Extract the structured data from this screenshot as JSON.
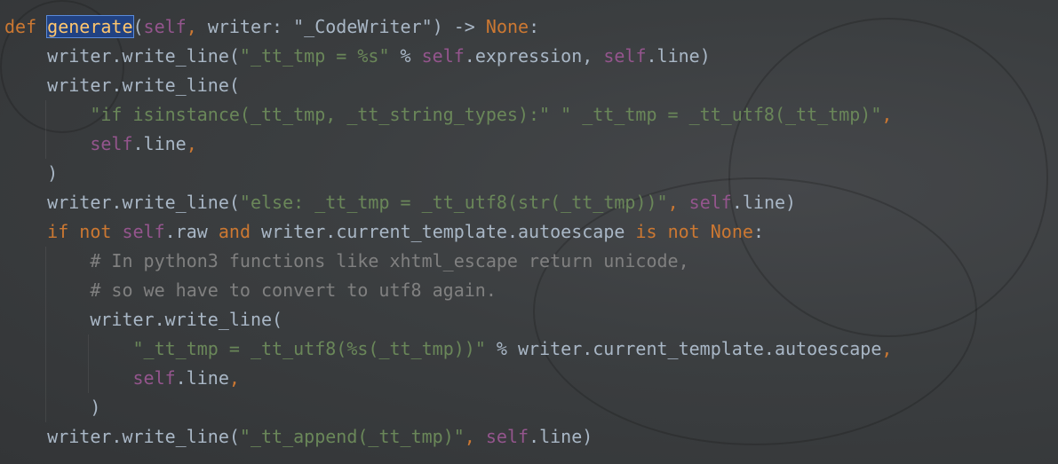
{
  "editor": {
    "language": "python",
    "colors": {
      "keyword": "#cc7832",
      "self": "#94558d",
      "string": "#6a8759",
      "comment": "#808080",
      "text": "#a9b7c6",
      "selection": "#214283"
    },
    "lines": [
      {
        "indent": 0,
        "tokens": [
          [
            "def ",
            "kw"
          ],
          [
            "generate",
            "sel"
          ],
          [
            "(",
            "txt"
          ],
          [
            "self",
            "self"
          ],
          [
            ", ",
            "kw"
          ],
          [
            "writer: ",
            "txt"
          ],
          [
            "\"_CodeWriter\"",
            "txt"
          ],
          [
            ") -> ",
            "txt"
          ],
          [
            "None",
            "kw"
          ],
          [
            ":",
            "txt"
          ]
        ]
      },
      {
        "indent": 1,
        "tokens": [
          [
            "writer.write_line(",
            "txt"
          ],
          [
            "\"_tt_tmp = %s\"",
            "str"
          ],
          [
            " % ",
            "txt"
          ],
          [
            "self",
            "self"
          ],
          [
            ".expression, ",
            "txt"
          ],
          [
            "self",
            "self"
          ],
          [
            ".line)",
            "txt"
          ]
        ]
      },
      {
        "indent": 1,
        "tokens": [
          [
            "writer.write_line(",
            "txt"
          ]
        ]
      },
      {
        "indent": 2,
        "tokens": [
          [
            "\"if isinstance(_tt_tmp, _tt_string_types):\" \" _tt_tmp = _tt_utf8(_tt_tmp)\"",
            "str"
          ],
          [
            ",",
            "kw"
          ]
        ]
      },
      {
        "indent": 2,
        "tokens": [
          [
            "self",
            "self"
          ],
          [
            ".line",
            "txt"
          ],
          [
            ",",
            "kw"
          ]
        ]
      },
      {
        "indent": 1,
        "tokens": [
          [
            ")",
            "txt"
          ]
        ]
      },
      {
        "indent": 1,
        "tokens": [
          [
            "writer.write_line(",
            "txt"
          ],
          [
            "\"else: _tt_tmp = _tt_utf8(str(_tt_tmp))\"",
            "str"
          ],
          [
            ", ",
            "kw"
          ],
          [
            "self",
            "self"
          ],
          [
            ".line)",
            "txt"
          ]
        ]
      },
      {
        "indent": 1,
        "tokens": [
          [
            "if not ",
            "kw"
          ],
          [
            "self",
            "self"
          ],
          [
            ".raw ",
            "txt"
          ],
          [
            "and ",
            "kw"
          ],
          [
            "writer.current_template.autoescape ",
            "txt"
          ],
          [
            "is not ",
            "kw"
          ],
          [
            "None",
            "kw"
          ],
          [
            ":",
            "txt"
          ]
        ]
      },
      {
        "indent": 2,
        "tokens": [
          [
            "# In python3 functions like xhtml_escape return unicode,",
            "cm"
          ]
        ]
      },
      {
        "indent": 2,
        "tokens": [
          [
            "# so we have to convert to utf8 again.",
            "cm"
          ]
        ]
      },
      {
        "indent": 2,
        "tokens": [
          [
            "writer.write_line(",
            "txt"
          ]
        ]
      },
      {
        "indent": 3,
        "tokens": [
          [
            "\"_tt_tmp = _tt_utf8(%s(_tt_tmp))\"",
            "str"
          ],
          [
            " % writer.current_template.autoescape",
            "txt"
          ],
          [
            ",",
            "kw"
          ]
        ]
      },
      {
        "indent": 3,
        "tokens": [
          [
            "self",
            "self"
          ],
          [
            ".line",
            "txt"
          ],
          [
            ",",
            "kw"
          ]
        ]
      },
      {
        "indent": 2,
        "tokens": [
          [
            ")",
            "txt"
          ]
        ]
      },
      {
        "indent": 1,
        "tokens": [
          [
            "writer.write_line(",
            "txt"
          ],
          [
            "\"_tt_append(_tt_tmp)\"",
            "str"
          ],
          [
            ", ",
            "kw"
          ],
          [
            "self",
            "self"
          ],
          [
            ".line)",
            "txt"
          ]
        ]
      }
    ]
  }
}
